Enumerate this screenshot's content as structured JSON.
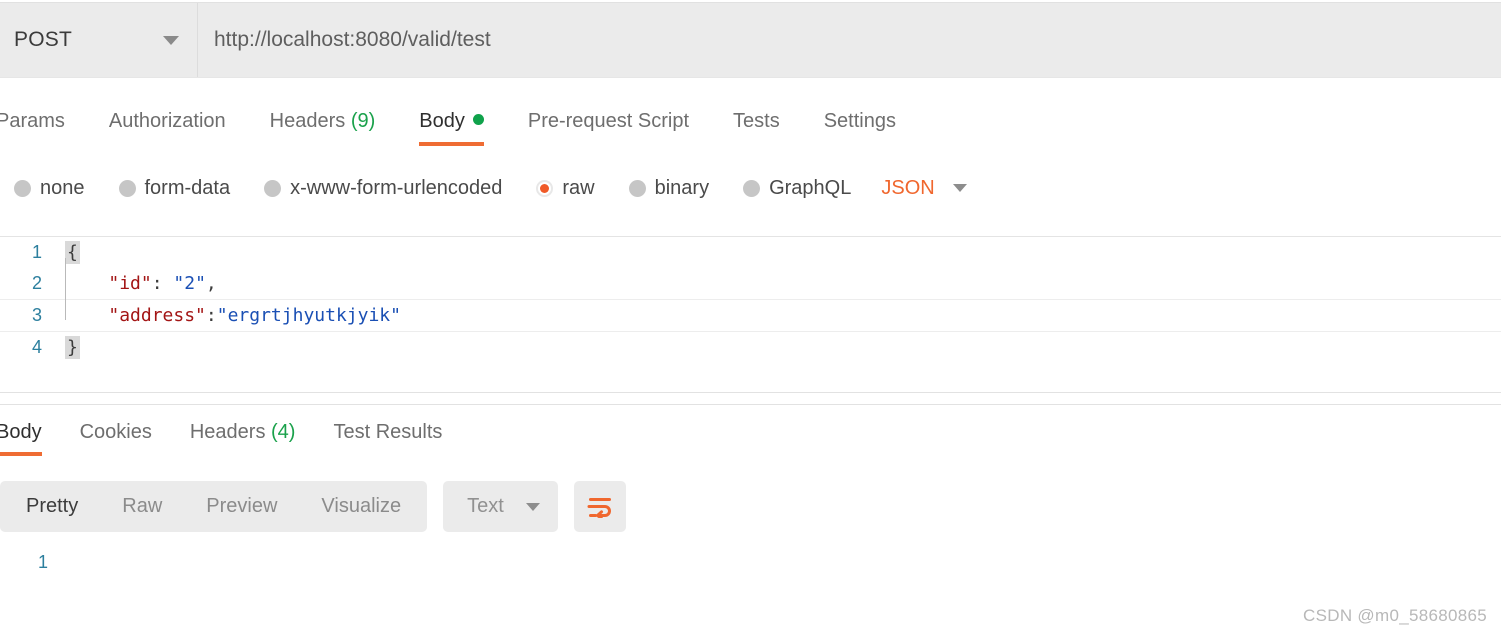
{
  "request_bar": {
    "method": "POST",
    "method_caret_icon": "chevron-down-icon",
    "url": "http://localhost:8080/valid/test"
  },
  "request_tabs": [
    {
      "label": "Params",
      "count": "",
      "active": false
    },
    {
      "label": "Authorization",
      "count": "",
      "active": false
    },
    {
      "label": "Headers",
      "count": "(9)",
      "active": false
    },
    {
      "label": "Body",
      "count": "",
      "active": true
    },
    {
      "label": "Pre-request Script",
      "count": "",
      "active": false
    },
    {
      "label": "Tests",
      "count": "",
      "active": false
    },
    {
      "label": "Settings",
      "count": "",
      "active": false
    }
  ],
  "body_type": {
    "options": [
      {
        "label": "none",
        "selected": false
      },
      {
        "label": "form-data",
        "selected": false
      },
      {
        "label": "x-www-form-urlencoded",
        "selected": false
      },
      {
        "label": "raw",
        "selected": true
      },
      {
        "label": "binary",
        "selected": false
      },
      {
        "label": "GraphQL",
        "selected": false
      }
    ],
    "format": "JSON",
    "format_caret_icon": "chevron-down-icon"
  },
  "request_editor": {
    "lines": [
      {
        "number": "1",
        "open_brace": "{",
        "active": false
      },
      {
        "number": "2",
        "indent": "    ",
        "key": "\"id\"",
        "sep": ": ",
        "value": "\"2\"",
        "comma": ",",
        "active": false
      },
      {
        "number": "3",
        "indent": "    ",
        "key": "\"address\"",
        "sep": ":",
        "value": "\"ergrtjhyutkjyik\"",
        "comma": "",
        "active": true
      },
      {
        "number": "4",
        "close_brace": "}",
        "active": false
      }
    ]
  },
  "response_tabs": [
    {
      "label": "Body",
      "count": "",
      "active": true
    },
    {
      "label": "Cookies",
      "count": "",
      "active": false
    },
    {
      "label": "Headers",
      "count": "(4)",
      "active": false
    },
    {
      "label": "Test Results",
      "count": "",
      "active": false
    }
  ],
  "response_toolbar": {
    "views": [
      {
        "label": "Pretty",
        "active": true
      },
      {
        "label": "Raw",
        "active": false
      },
      {
        "label": "Preview",
        "active": false
      },
      {
        "label": "Visualize",
        "active": false
      }
    ],
    "content_type": "Text",
    "content_type_caret_icon": "chevron-down-icon",
    "wrap_button_icon": "word-wrap-icon"
  },
  "response_body": {
    "lines": [
      {
        "number": "1",
        "text": ""
      }
    ]
  },
  "watermark": "CSDN @m0_58680865",
  "colors": {
    "accent_orange": "#ef6c33",
    "status_green": "#0fa24b",
    "json_orange": "#f0672e",
    "gutter_blue": "#2c7f9e",
    "json_key": "#a31515",
    "json_string": "#1a4fb4",
    "toolbar_gray": "#ebebeb"
  }
}
